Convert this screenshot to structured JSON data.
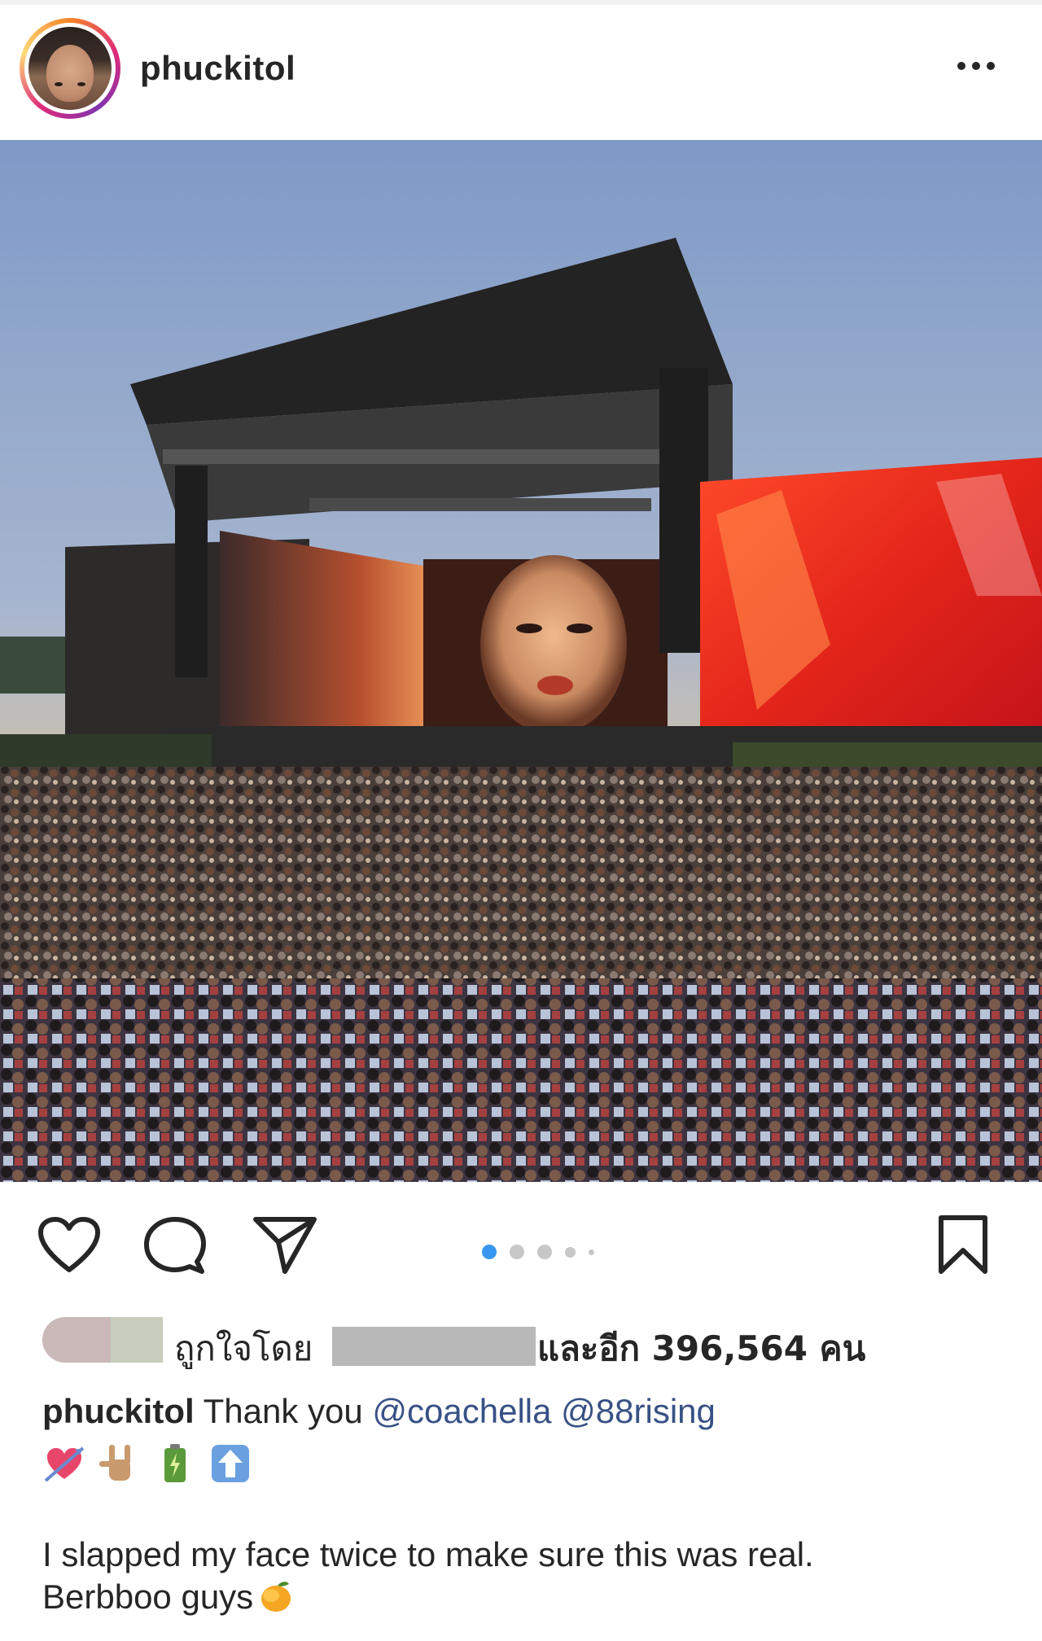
{
  "post": {
    "username": "phuckitol",
    "likes": {
      "prefix": "ถูกใจโดย",
      "suffix": "และอีก 396,564 คน"
    },
    "caption": {
      "username": "phuckitol",
      "text": "Thank you",
      "mentions": [
        "@coachella",
        "@88rising"
      ],
      "emojis": [
        "heart-with-arrow-icon",
        "love-you-gesture-icon",
        "battery-icon",
        "up-arrow-icon"
      ],
      "body_line1": "I slapped my face twice to make sure this was real.",
      "body_line2": "Berbboo guys"
    },
    "carousel": {
      "count": 5,
      "active": 1
    }
  },
  "colors": {
    "mention": "#385185",
    "carousel_active": "#3897f0",
    "text": "#262626"
  }
}
